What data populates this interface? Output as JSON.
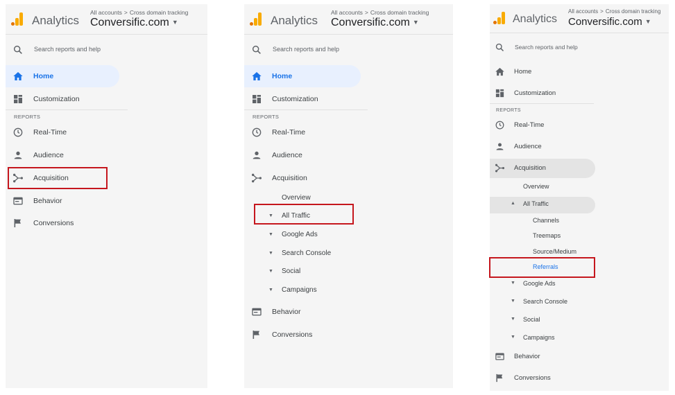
{
  "header": {
    "app_name": "Analytics",
    "breadcrumb_all": "All accounts",
    "breadcrumb_sep": ">",
    "breadcrumb_sub": "Cross domain tracking",
    "account": "Conversific.com",
    "caret": "▼"
  },
  "nav": {
    "search": "Search reports and help",
    "home": "Home",
    "customization": "Customization",
    "reports_header": "REPORTS",
    "realtime": "Real-Time",
    "audience": "Audience",
    "acquisition": "Acquisition",
    "behavior": "Behavior",
    "conversions": "Conversions"
  },
  "acquisition_menu": {
    "overview": "Overview",
    "all_traffic": "All Traffic",
    "google_ads": "Google Ads",
    "search_console": "Search Console",
    "social": "Social",
    "campaigns": "Campaigns"
  },
  "all_traffic_menu": {
    "channels": "Channels",
    "treemaps": "Treemaps",
    "source_medium": "Source/Medium",
    "referrals": "Referrals"
  },
  "colors": {
    "brand_orange": "#f9ab00",
    "brand_dark_orange": "#e37400",
    "home_blue": "#1a73e8",
    "highlight_red": "#c5161d"
  }
}
